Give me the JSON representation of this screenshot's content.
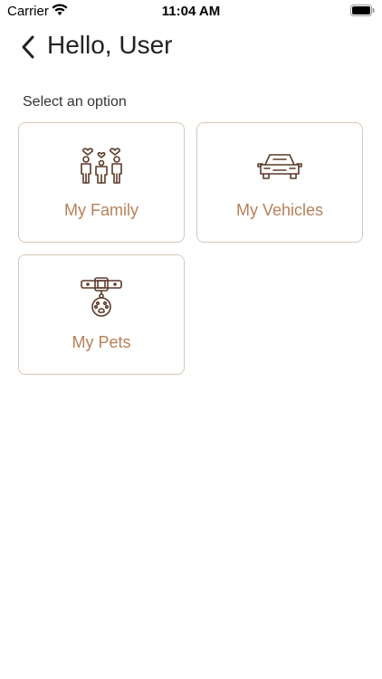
{
  "status_bar": {
    "carrier": "Carrier",
    "time": "11:04 AM"
  },
  "nav": {
    "title": "Hello, User"
  },
  "main": {
    "prompt": "Select an option",
    "options": [
      {
        "label": "My Family",
        "icon": "family-icon"
      },
      {
        "label": "My Vehicles",
        "icon": "car-icon"
      },
      {
        "label": "My Pets",
        "icon": "pet-collar-icon"
      }
    ]
  },
  "colors": {
    "accent": "#b88058",
    "icon": "#5b3a28",
    "card_border": "#d9c7b6"
  }
}
